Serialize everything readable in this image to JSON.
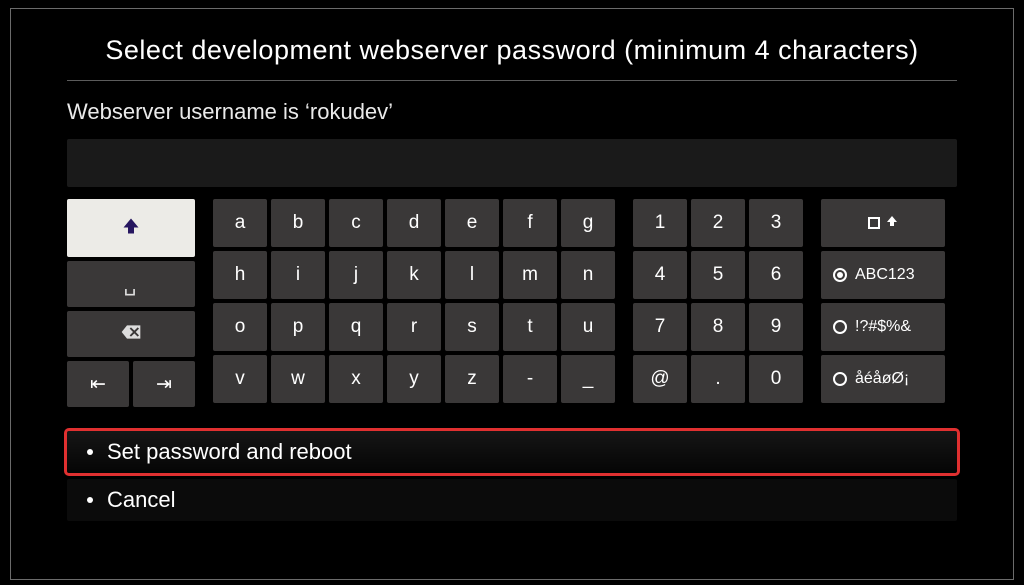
{
  "title": "Select development webserver password (minimum 4 characters)",
  "subtitle": "Webserver username is ‘rokudev’",
  "input": {
    "value": ""
  },
  "keyboard": {
    "letters": [
      [
        "a",
        "b",
        "c",
        "d",
        "e",
        "f",
        "g"
      ],
      [
        "h",
        "i",
        "j",
        "k",
        "l",
        "m",
        "n"
      ],
      [
        "o",
        "p",
        "q",
        "r",
        "s",
        "t",
        "u"
      ],
      [
        "v",
        "w",
        "x",
        "y",
        "z",
        "-",
        "_"
      ]
    ],
    "numbers": [
      [
        "1",
        "2",
        "3"
      ],
      [
        "4",
        "5",
        "6"
      ],
      [
        "7",
        "8",
        "9"
      ],
      [
        "@",
        ".",
        "0"
      ]
    ],
    "modes": {
      "abc": "ABC123",
      "sym": "!?#$%&",
      "intl": "åéåøØ¡"
    },
    "special": {
      "space_glyph": "␣",
      "larrow": "⇤",
      "rarrow": "⇥"
    }
  },
  "options": {
    "set_password": "Set password and reboot",
    "cancel": "Cancel"
  }
}
